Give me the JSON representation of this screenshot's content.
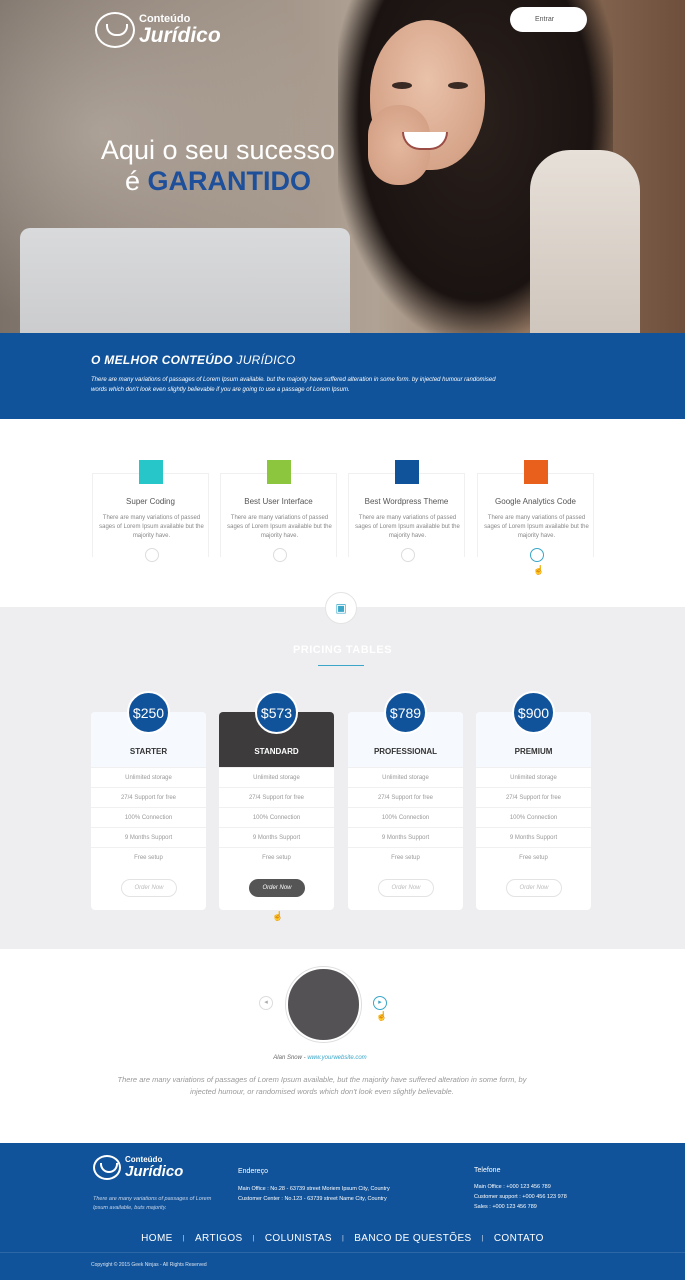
{
  "header": {
    "logo": {
      "small": "Conteúdo",
      "big": "Jurídico"
    },
    "enter_button": "Entrar",
    "hero_line1": "Aqui o seu sucesso",
    "hero_line2_prefix": "é ",
    "hero_line2_accent": "GARANTIDO"
  },
  "band": {
    "title_bold": "O MELHOR CONTEÚDO ",
    "title_thin": "JURÍDICO",
    "text": "There are many variations of passages of Lorem Ipsum available. but the majority have suffered alteration in some form. by injected humour randomised words which don't look even slightly believable if you are going to use a passage of Lorem Ipsum."
  },
  "features": [
    {
      "title": "Super Coding",
      "desc": "There are many variations of passed sages of Lorem Ipsum available but the majority have.",
      "color": "#26c6c9"
    },
    {
      "title": "Best User Interface",
      "desc": "There are many variations of passed sages of Lorem Ipsum available but the majority have.",
      "color": "#8cc63f"
    },
    {
      "title": "Best Wordpress Theme",
      "desc": "There are many variations of passed sages of Lorem Ipsum available but the majority have.",
      "color": "#11539a"
    },
    {
      "title": "Google Analytics Code",
      "desc": "There are many variations of passed sages of Lorem Ipsum available but the majority have.",
      "color": "#e8601c"
    }
  ],
  "pricing": {
    "title": "PRICING TABLES",
    "plans": [
      {
        "price": "$250",
        "name": "STARTER"
      },
      {
        "price": "$573",
        "name": "STANDARD"
      },
      {
        "price": "$789",
        "name": "PROFESSIONAL"
      },
      {
        "price": "$900",
        "name": "PREMIUM"
      }
    ],
    "features": [
      "Unlimited storage",
      "27/4 Support for free",
      "100% Connection",
      "9 Months Support",
      "Free setup"
    ],
    "order_label": "Order Now"
  },
  "testimonial": {
    "author": "Alan Snow",
    "separator": " - ",
    "site": "www.yourwebsite.com",
    "quote": "There are many variations of passages of Lorem Ipsum available, but the majority have suffered alteration in some form, by injected humour, or randomised words which don't look even slightly believable."
  },
  "footer": {
    "logo": {
      "small": "Conteúdo",
      "big": "Jurídico"
    },
    "desc": "There are many variations of passages of Lorem Ipsum available, buts majority.",
    "address_title": "Endereço",
    "address_lines": [
      "Main Office :  No.28 - 63739 street Moriem Ipsum City, Country",
      "Customer Center :  No.123 - 63739 street Name City, Country"
    ],
    "phone_title": "Telefone",
    "phone_lines": [
      "Main Office :  +000 123 456 789",
      "Customer support :  +000 456 123 978",
      "Sales :  +000 123 456 789"
    ],
    "menu": [
      "HOME",
      "ARTIGOS",
      "COLUNISTAS",
      "BANCO DE QUESTÕES",
      "CONTATO"
    ],
    "copyright": "Copyright © 2015 Geek Ninjas - All Rights Reserved"
  }
}
